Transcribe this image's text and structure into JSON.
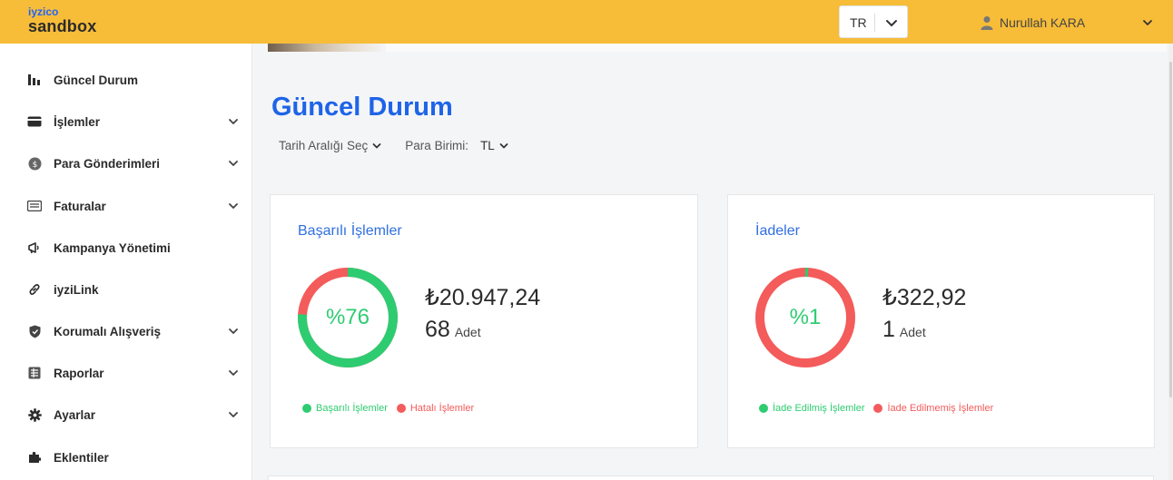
{
  "header": {
    "brand": "iyzico",
    "environment": "sandbox",
    "language": "TR",
    "user_name": "Nurullah KARA"
  },
  "sidebar": {
    "items": [
      {
        "label": "Güncel Durum",
        "icon": "bar-chart-icon",
        "has_chevron": false
      },
      {
        "label": "İşlemler",
        "icon": "card-icon",
        "has_chevron": true
      },
      {
        "label": "Para Gönderimleri",
        "icon": "dollar-coin-icon",
        "has_chevron": true
      },
      {
        "label": "Faturalar",
        "icon": "invoice-icon",
        "has_chevron": true
      },
      {
        "label": "Kampanya Yönetimi",
        "icon": "megaphone-icon",
        "has_chevron": false
      },
      {
        "label": "iyziLink",
        "icon": "link-icon",
        "has_chevron": false
      },
      {
        "label": "Korumalı Alışveriş",
        "icon": "shield-icon",
        "has_chevron": true
      },
      {
        "label": "Raporlar",
        "icon": "report-icon",
        "has_chevron": true
      },
      {
        "label": "Ayarlar",
        "icon": "gear-icon",
        "has_chevron": true
      },
      {
        "label": "Eklentiler",
        "icon": "puzzle-icon",
        "has_chevron": false
      }
    ]
  },
  "main": {
    "title": "Güncel Durum",
    "date_filter": "Tarih Aralığı Seç",
    "currency_label": "Para Birimi:",
    "currency_value": "TL"
  },
  "cards": [
    {
      "title": "Başarılı İşlemler",
      "percent_text": "%76",
      "percent_value": 76,
      "amount": "₺20.947,24",
      "count": "68",
      "count_unit": "Adet",
      "legend": [
        {
          "label": "Başarılı İşlemler",
          "color": "#2ecc71"
        },
        {
          "label": "Hatalı İşlemler",
          "color": "#f45b5b"
        }
      ]
    },
    {
      "title": "İadeler",
      "percent_text": "%1",
      "percent_value": 1,
      "amount": "₺322,92",
      "count": "1",
      "count_unit": "Adet",
      "legend": [
        {
          "label": "İade Edilmiş İşlemler",
          "color": "#2ecc71"
        },
        {
          "label": "İade Edilmemiş İşlemler",
          "color": "#f45b5b"
        }
      ]
    }
  ],
  "colors": {
    "header_bg": "#f7bc38",
    "accent_blue": "#1e64e8",
    "success": "#2ecc71",
    "danger": "#f45b5b"
  }
}
